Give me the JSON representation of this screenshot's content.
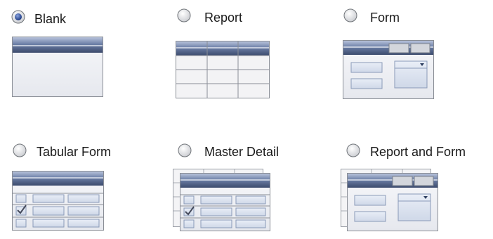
{
  "options": [
    {
      "label": "Blank",
      "selected": true,
      "icon": "blank-page-icon"
    },
    {
      "label": "Report",
      "selected": false,
      "icon": "report-page-icon"
    },
    {
      "label": "Form",
      "selected": false,
      "icon": "form-page-icon"
    },
    {
      "label": "Tabular Form",
      "selected": false,
      "icon": "tabular-form-page-icon"
    },
    {
      "label": "Master Detail",
      "selected": false,
      "icon": "master-detail-page-icon"
    },
    {
      "label": "Report and Form",
      "selected": false,
      "icon": "report-and-form-page-icon"
    }
  ],
  "colors": {
    "header": "#4f5f80",
    "body": "#f1f1f4",
    "field": "#d9e1ee",
    "radio_selected": "#1e3d8a"
  }
}
